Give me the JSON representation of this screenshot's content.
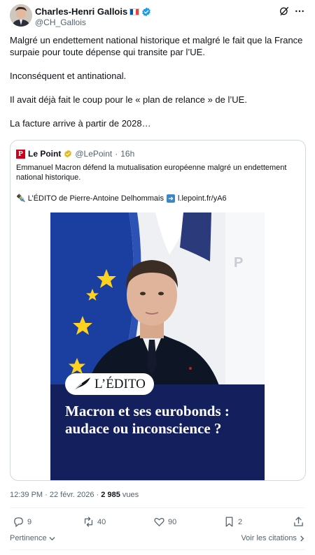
{
  "author": {
    "display_name": "Charles-Henri Gallois",
    "handle": "@CH_Gallois",
    "flag_colors": [
      "#0055a4",
      "#ffffff",
      "#ef4135"
    ],
    "verified_color": "#1d9bf0"
  },
  "tweet": {
    "paragraphs": [
      "Malgré un endettement national historique et malgré le fait que la France surpaie pour toute dépense qui transite par l’UE.",
      "Inconséquent et antinational.",
      "Il avait déjà fait le coup pour le « plan de relance » de l’UE.",
      "La facture arrive à partir de 2028…"
    ]
  },
  "quote": {
    "name": "Le Point",
    "logo_letter": "P",
    "handle": "@LePoint",
    "separator": "·",
    "time": "16h",
    "text": "Emmanuel Macron défend la mutualisation européenne malgré un endettement national historique.",
    "link_prefix": "✒️ L’ÉDITO de Pierre-Antoine Delhommais",
    "link_url": "l.lepoint.fr/yA6",
    "image": {
      "tag": "L’ÉDITO",
      "headline": "Macron et ses eurobonds : audace ou inconscience ?"
    }
  },
  "meta": {
    "time": "12:39 PM",
    "separator": "·",
    "date": "22 févr. 2026",
    "views": "2 985",
    "views_label": "vues"
  },
  "actions": {
    "replies": "9",
    "reposts": "40",
    "likes": "90",
    "bookmarks": "2"
  },
  "footer": {
    "sort_label": "Pertinence",
    "quotes_label": "Voir les citations"
  },
  "colors": {
    "text": "#0f1419",
    "secondary": "#536471",
    "border": "#cfd9de",
    "banner": "#14205e",
    "eu_blue": "#1b3fa1",
    "eu_star": "#ffd21f",
    "le_point_red": "#d0021b"
  }
}
